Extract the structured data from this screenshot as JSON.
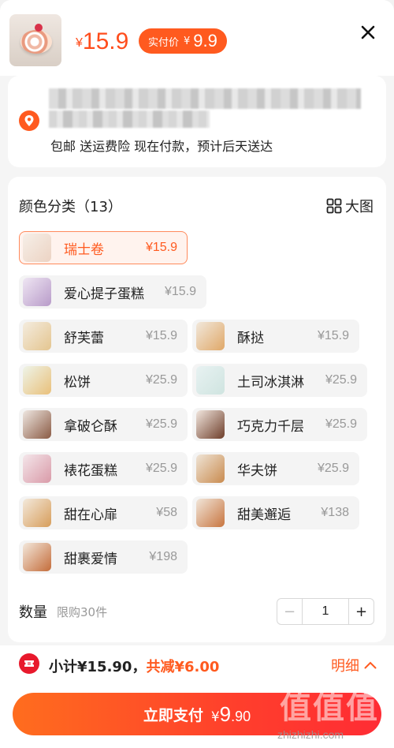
{
  "header": {
    "price_currency": "¥",
    "price_value": "15.9",
    "actual_pay_label": "实付价",
    "actual_pay_currency": "¥",
    "actual_pay_value": "9.9",
    "close_icon": "close-icon"
  },
  "address": {
    "icon": "location-pin-icon",
    "note": "包邮 送运费险 现在付款，预计后天送达"
  },
  "options": {
    "title": "颜色分类（13）",
    "view_big_label": "大图",
    "view_big_icon": "grid-icon",
    "items": [
      {
        "name": "瑞士卷",
        "price": "¥15.9",
        "selected": true
      },
      {
        "name": "爱心提子蛋糕",
        "price": "¥15.9",
        "selected": false
      },
      {
        "name": "舒芙蕾",
        "price": "¥15.9",
        "selected": false
      },
      {
        "name": "酥挞",
        "price": "¥15.9",
        "selected": false
      },
      {
        "name": "松饼",
        "price": "¥25.9",
        "selected": false
      },
      {
        "name": "土司冰淇淋",
        "price": "¥25.9",
        "selected": false
      },
      {
        "name": "拿破仑酥",
        "price": "¥25.9",
        "selected": false
      },
      {
        "name": "巧克力千层",
        "price": "¥25.9",
        "selected": false
      },
      {
        "name": "裱花蛋糕",
        "price": "¥25.9",
        "selected": false
      },
      {
        "name": "华夫饼",
        "price": "¥25.9",
        "selected": false
      },
      {
        "name": "甜在心扉",
        "price": "¥58",
        "selected": false
      },
      {
        "name": "甜美邂逅",
        "price": "¥138",
        "selected": false
      },
      {
        "name": "甜裹爱情",
        "price": "¥198",
        "selected": false
      }
    ]
  },
  "quantity": {
    "label": "数量",
    "limit": "限购30件",
    "minus": "−",
    "value": "1",
    "plus": "+"
  },
  "footer": {
    "subtotal_label": "小计¥15.90，",
    "discount_label": "共减¥6.00",
    "detail_label": "明细",
    "pay_label": "立即支付",
    "pay_currency": "¥",
    "pay_int": "9",
    "pay_dec": ".90",
    "watermark_logo": "值值值",
    "watermark_text": "zhizhizhi.com",
    "accent_color": "#ff5a1f"
  }
}
